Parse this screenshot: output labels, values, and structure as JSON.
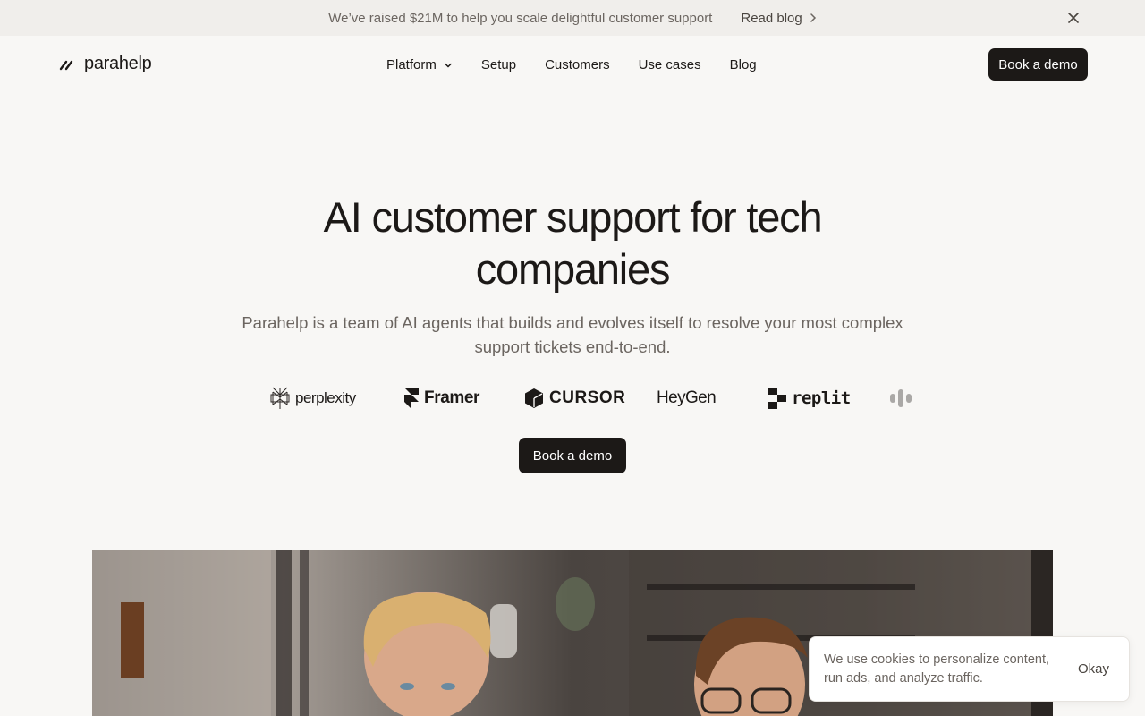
{
  "announcement": {
    "message": "We’ve raised $21M to help you scale delightful customer support",
    "link_label": "Read blog"
  },
  "nav": {
    "brand": "parahelp",
    "items": [
      {
        "label": "Platform",
        "has_dropdown": true
      },
      {
        "label": "Setup"
      },
      {
        "label": "Customers"
      },
      {
        "label": "Use cases"
      },
      {
        "label": "Blog"
      }
    ],
    "cta": "Book a demo"
  },
  "hero": {
    "title_line1": "AI customer support for tech",
    "title_line2": "companies",
    "subtitle_line1": "Parahelp is a team of AI agents that builds and evolves itself to resolve your most complex",
    "subtitle_line2": "support tickets end-to-end.",
    "cta": "Book a demo"
  },
  "customer_logos": [
    "perplexity",
    "Framer",
    "CURSOR",
    "HeyGen",
    "replit"
  ],
  "cookie_banner": {
    "text": "We use cookies to personalize content, run ads, and analyze traffic.",
    "button": "Okay"
  },
  "colors": {
    "background": "#f8f7f5",
    "announcement_bar": "#f0eeeb",
    "primary_button": "#1c1917",
    "muted_text": "#6b6560"
  }
}
